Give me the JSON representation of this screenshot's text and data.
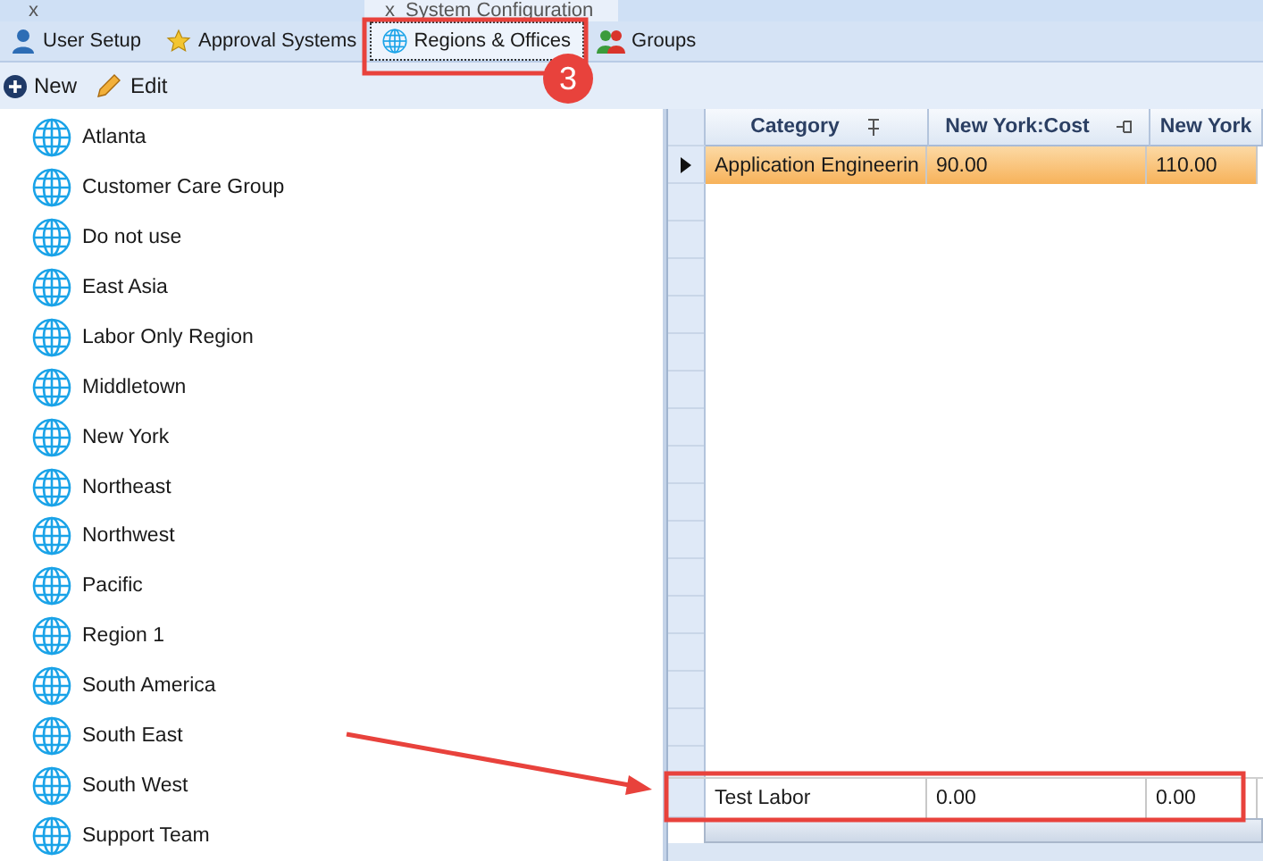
{
  "document_tabs": [
    {
      "label": "x",
      "kind": "close"
    },
    {
      "label": "System Configuration",
      "kind": "doc",
      "close": "x"
    }
  ],
  "tabs": [
    {
      "label": "User Setup",
      "kind": "person",
      "selected": false
    },
    {
      "label": "Approval Systems",
      "kind": "star",
      "selected": false
    },
    {
      "label": "Regions & Offices",
      "kind": "globe",
      "selected": true
    },
    {
      "label": "Groups",
      "kind": "people",
      "selected": false
    }
  ],
  "toolbar": [
    {
      "label": "New",
      "kind": "plus"
    },
    {
      "label": "Edit",
      "kind": "pencil"
    }
  ],
  "regions": [
    "Atlanta",
    "Customer Care Group",
    "Do not use",
    "East Asia",
    "Labor Only Region",
    "Middletown",
    "New York",
    "Northeast",
    "Northwest",
    "Pacific",
    "Region 1",
    "South America",
    "South East",
    "South West",
    "Support Team"
  ],
  "grid": {
    "columns": [
      "Category",
      "New York:Cost",
      "New York"
    ],
    "rows": [
      {
        "cells": [
          "Application Engineerin",
          "90.00",
          "110.00"
        ],
        "selected": true
      }
    ],
    "footer": [
      "Test Labor",
      "0.00",
      "0.00"
    ]
  },
  "annotation": {
    "badge": "3"
  }
}
